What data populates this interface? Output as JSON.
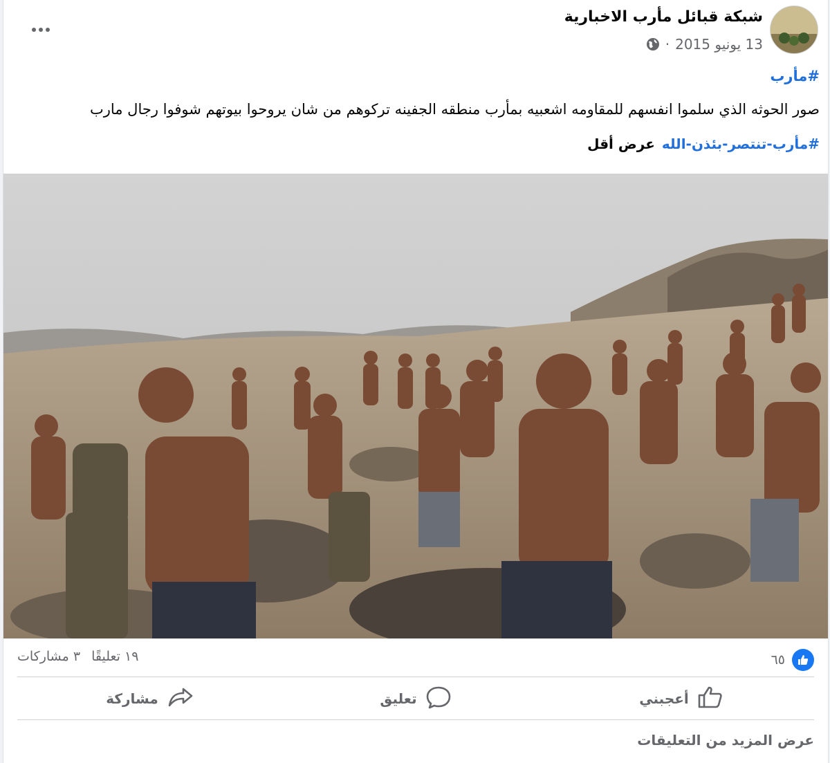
{
  "post": {
    "page_name": "شبكة قبائل مأرب الاخبارية",
    "date": "13 يونيو 2015",
    "separator": "·",
    "avatar_text": "شبكة قبائل مأرب الأخبارية",
    "hashtag": "#مأرب",
    "body": "صور الحوثه الذي سلموا انفسهم للمقاومه اشعبيه بمأرب منطقه الجفينه تركوهم من شان يروحوا بيوتهم شوفوا رجال مارب",
    "tags": "#مأرب-تنتصر-بئذن-الله",
    "see_less": "عرض أقل"
  },
  "stats": {
    "likes": "٦٥",
    "comments": "١٩ تعليقًا",
    "shares": "٣ مشاركات"
  },
  "actions": {
    "like": "أعجبني",
    "comment": "تعليق",
    "share": "مشاركة"
  },
  "more_comments": "عرض المزيد من التعليقات",
  "colors": {
    "accent": "#1877f2",
    "hashtag": "#216fdb",
    "secondary_text": "#65676b"
  },
  "icons": [
    "globe-icon",
    "more-options-icon",
    "like-reaction-icon",
    "like-icon",
    "comment-icon",
    "share-icon"
  ]
}
